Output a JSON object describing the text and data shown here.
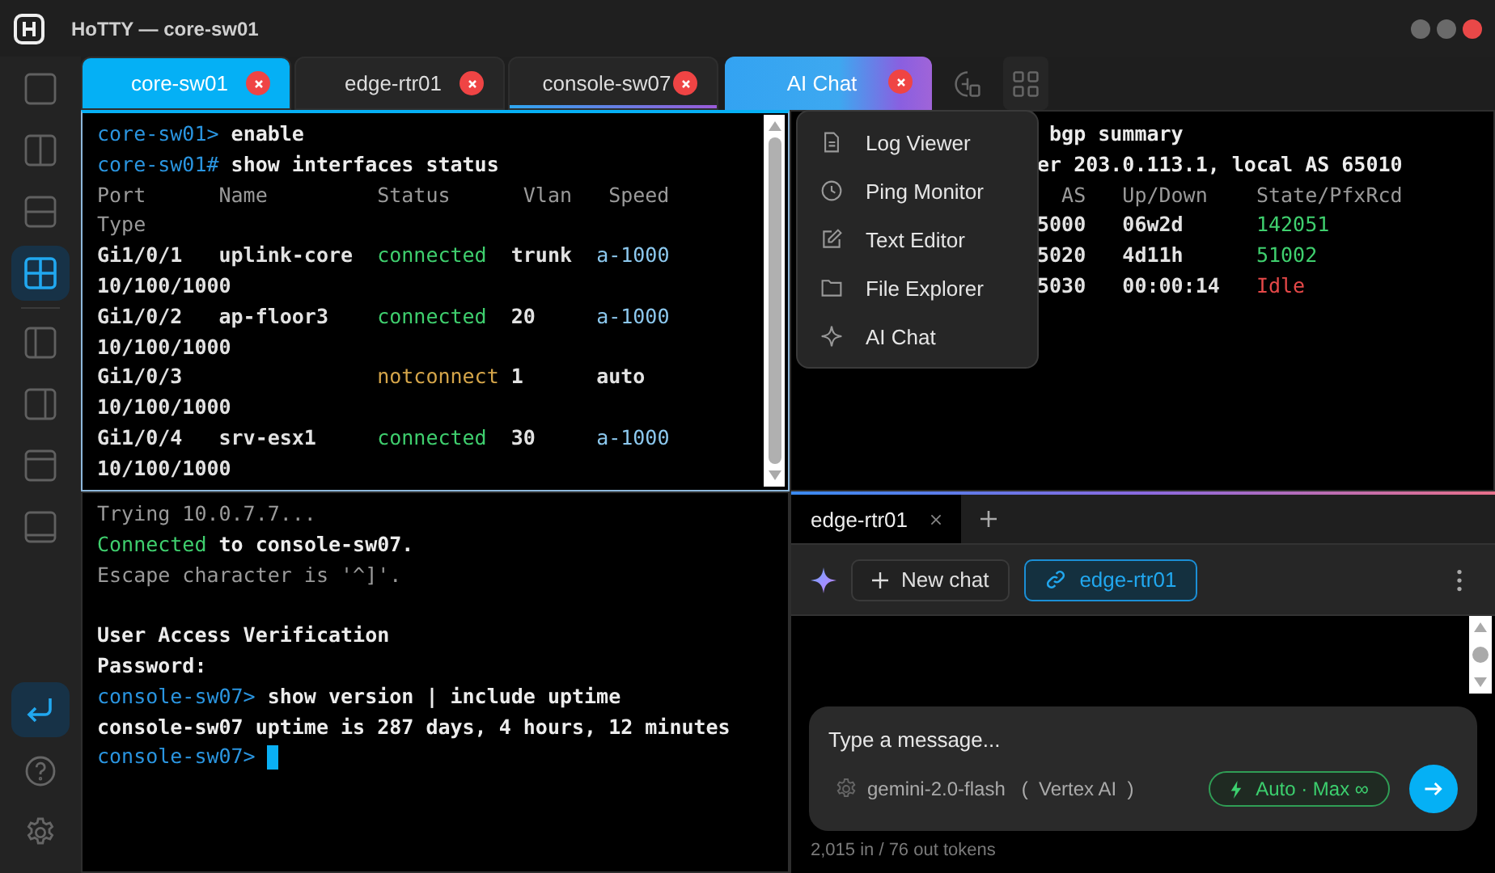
{
  "window": {
    "title": "HoTTY — core-sw01"
  },
  "sidebar": {
    "layouts": [
      {
        "kind": "single",
        "selected": false
      },
      {
        "kind": "columns",
        "selected": false
      },
      {
        "kind": "rows",
        "selected": false
      },
      {
        "kind": "grid",
        "selected": true
      },
      {
        "kind": "left-wide",
        "selected": false
      },
      {
        "kind": "right-wide",
        "selected": false
      },
      {
        "kind": "header",
        "selected": false
      },
      {
        "kind": "footer",
        "selected": false
      }
    ],
    "actions": [
      {
        "kind": "enter",
        "selected": true
      },
      {
        "kind": "help",
        "selected": false
      },
      {
        "kind": "settings",
        "selected": false
      }
    ]
  },
  "tabs": [
    {
      "label": "core-sw01",
      "kind": "terminal",
      "selected": true,
      "underline": false
    },
    {
      "label": "edge-rtr01",
      "kind": "terminal",
      "selected": false,
      "underline": false
    },
    {
      "label": "console-sw07",
      "kind": "terminal",
      "selected": false,
      "underline": true
    },
    {
      "label": "AI Chat",
      "kind": "ai",
      "selected": false,
      "underline": false
    }
  ],
  "terminals": [
    {
      "focused": true,
      "scrollbar": true,
      "lines": [
        {
          "segments": [
            {
              "text": "core-sw01> ",
              "kind": "prompt"
            },
            {
              "text": "enable",
              "kind": "command"
            }
          ]
        },
        {
          "segments": [
            {
              "text": "core-sw01# ",
              "kind": "prompt"
            },
            {
              "text": "show interfaces status",
              "kind": "command"
            }
          ]
        },
        {
          "segments": [
            {
              "text": "Port      Name         Status      Vlan   Speed",
              "kind": "header"
            }
          ]
        },
        {
          "segments": [
            {
              "text": "Type",
              "kind": "header"
            }
          ]
        },
        {
          "segments": [
            {
              "text": "Gi1/0/1   uplink-core  ",
              "kind": "plain"
            },
            {
              "text": "connected",
              "kind": "ok"
            },
            {
              "text": "  trunk  ",
              "kind": "plain"
            },
            {
              "text": "a-1000",
              "kind": "speed"
            }
          ]
        },
        {
          "segments": [
            {
              "text": "10/100/1000",
              "kind": "plain"
            }
          ]
        },
        {
          "segments": [
            {
              "text": "Gi1/0/2   ap-floor3    ",
              "kind": "plain"
            },
            {
              "text": "connected",
              "kind": "ok"
            },
            {
              "text": "  20     ",
              "kind": "plain"
            },
            {
              "text": "a-1000",
              "kind": "speed"
            }
          ]
        },
        {
          "segments": [
            {
              "text": "10/100/1000",
              "kind": "plain"
            }
          ]
        },
        {
          "segments": [
            {
              "text": "Gi1/0/3                ",
              "kind": "plain"
            },
            {
              "text": "notconnect",
              "kind": "warn"
            },
            {
              "text": " 1      auto",
              "kind": "plain"
            }
          ]
        },
        {
          "segments": [
            {
              "text": "10/100/1000",
              "kind": "plain"
            }
          ]
        },
        {
          "segments": [
            {
              "text": "Gi1/0/4   srv-esx1     ",
              "kind": "plain"
            },
            {
              "text": "connected",
              "kind": "ok"
            },
            {
              "text": "  30     ",
              "kind": "plain"
            },
            {
              "text": "a-1000",
              "kind": "speed"
            }
          ]
        },
        {
          "segments": [
            {
              "text": "10/100/1000",
              "kind": "plain"
            }
          ]
        }
      ]
    },
    {
      "focused": false,
      "lines": [
        {
          "segments": [
            {
              "text": " bgp summary",
              "kind": "command"
            }
          ]
        },
        {
          "segments": [
            {
              "text": "er 203.0.113.1, local AS 65010",
              "kind": "command"
            }
          ]
        },
        {
          "segments": [
            {
              "text": "  AS   Up/Down    State/PfxRcd",
              "kind": "header"
            }
          ]
        },
        {
          "segments": [
            {
              "text": "5000   06w2d      ",
              "kind": "plain"
            },
            {
              "text": "142051",
              "kind": "ok"
            }
          ]
        },
        {
          "segments": [
            {
              "text": "5020   4d11h      ",
              "kind": "plain"
            },
            {
              "text": "51002",
              "kind": "ok"
            }
          ]
        },
        {
          "segments": [
            {
              "text": "5030   00:00:14   ",
              "kind": "plain"
            },
            {
              "text": "Idle",
              "kind": "error"
            }
          ]
        }
      ]
    },
    {
      "focused": false,
      "cursor": true,
      "lines": [
        {
          "segments": [
            {
              "text": "Trying 10.0.7.7...",
              "kind": "header"
            }
          ]
        },
        {
          "segments": [
            {
              "text": "Connected",
              "kind": "ok"
            },
            {
              "text": " to console-sw07.",
              "kind": "command"
            }
          ]
        },
        {
          "segments": [
            {
              "text": "Escape character is '^]'.",
              "kind": "header"
            }
          ]
        },
        {
          "kind": "blank"
        },
        {
          "segments": [
            {
              "text": "User Access Verification",
              "kind": "command"
            }
          ]
        },
        {
          "segments": [
            {
              "text": "Password:",
              "kind": "command"
            }
          ]
        },
        {
          "segments": [
            {
              "text": "console-sw07> ",
              "kind": "prompt"
            },
            {
              "text": "show version | include uptime",
              "kind": "command"
            }
          ]
        },
        {
          "segments": [
            {
              "text": "console-sw07 uptime is 287 days, 4 hours, 12 minutes",
              "kind": "command"
            }
          ]
        },
        {
          "segments": [
            {
              "text": "console-sw07> ",
              "kind": "prompt"
            }
          ]
        }
      ]
    }
  ],
  "menu": {
    "items": [
      {
        "label": "Log Viewer",
        "kind": "log"
      },
      {
        "label": "Ping Monitor",
        "kind": "ping"
      },
      {
        "label": "Text Editor",
        "kind": "editor"
      },
      {
        "label": "File Explorer",
        "kind": "files"
      },
      {
        "label": "AI Chat",
        "kind": "ai"
      }
    ]
  },
  "chat": {
    "tabs": [
      {
        "label": "edge-rtr01",
        "selected": true
      }
    ],
    "new_chat": "New chat",
    "context": "edge-rtr01",
    "placeholder": "Type a message...",
    "model": "gemini-2.0-flash",
    "provider": "(  Vertex AI  )",
    "mode": "Auto · Max ∞",
    "tokens": "2,015 in / 76 out tokens"
  }
}
